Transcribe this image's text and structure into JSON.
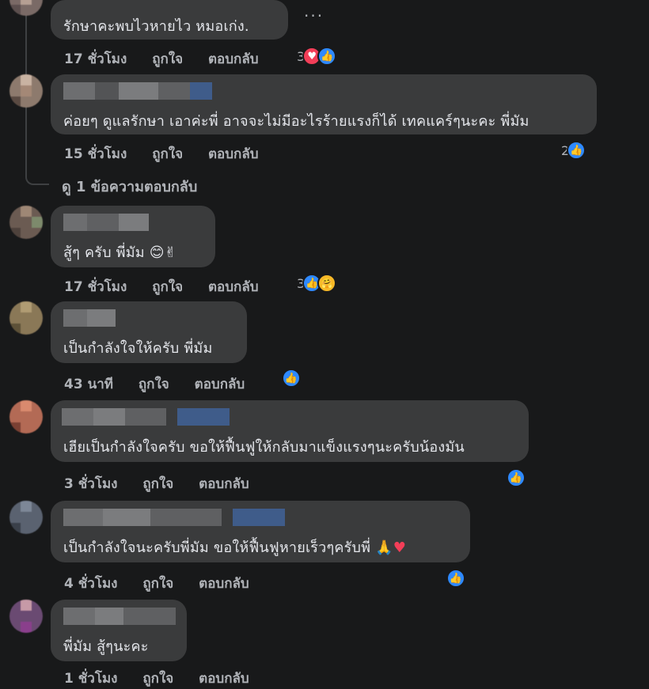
{
  "comments": [
    {
      "text": "รักษาคะพบไวหายไว หมอเก่ง.",
      "time": "17 ชั่วโมง",
      "like_label": "ถูกใจ",
      "reply_label": "ตอบกลับ",
      "reaction_count": "3",
      "reactions": [
        "love",
        "like"
      ],
      "more_label": "..."
    },
    {
      "text": "ค่อยๆ ดูแลรักษา เอาค่ะพี่ อาจจะไม่มีอะไรร้ายแรงก็ได้ เทคแคร์ๆนะคะ พี่มัม",
      "time": "15 ชั่วโมง",
      "like_label": "ถูกใจ",
      "reply_label": "ตอบกลับ",
      "reaction_count": "2",
      "reactions": [
        "like"
      ]
    },
    {
      "text": "สู้ๆ ครับ พี่มัม",
      "emoji": "😊✌",
      "time": "17 ชั่วโมง",
      "like_label": "ถูกใจ",
      "reply_label": "ตอบกลับ",
      "reaction_count": "3",
      "reactions": [
        "like",
        "care"
      ]
    },
    {
      "text": "เป็นกำลังใจให้ครับ พี่มัม",
      "time": "43 นาที",
      "like_label": "ถูกใจ",
      "reply_label": "ตอบกลับ",
      "reactions": [
        "like"
      ]
    },
    {
      "text": "เฮียเป็นกำลังใจครับ ขอให้ฟื้นฟูให้กลับมาแข็งแรงๆนะครับน้องมัน",
      "time": "3 ชั่วโมง",
      "like_label": "ถูกใจ",
      "reply_label": "ตอบกลับ",
      "reactions": [
        "like"
      ]
    },
    {
      "text": "เป็นกำลังใจนะครับพี่มัม ขอให้ฟื้นฟูหายเร็วๆครับพี่",
      "emoji": "🙏♥",
      "time": "4 ชั่วโมง",
      "like_label": "ถูกใจ",
      "reply_label": "ตอบกลับ",
      "reactions": [
        "like"
      ]
    },
    {
      "text": "พี่มัม สู้ๆนะคะ",
      "time": "1 ชั่วโมง",
      "like_label": "ถูกใจ",
      "reply_label": "ตอบกลับ"
    }
  ],
  "view_replies_label": "ดู 1 ข้อความตอบกลับ",
  "icons": {
    "like": "thumbs-up-icon",
    "love": "heart-icon",
    "care": "care-hug-icon"
  },
  "colors": {
    "background": "#18191a",
    "bubble": "#3a3b3c",
    "text": "#e4e6eb",
    "secondary": "#b0b3b8",
    "like": "#2e89ff",
    "love": "#f33e58",
    "care": "#f7b928"
  }
}
